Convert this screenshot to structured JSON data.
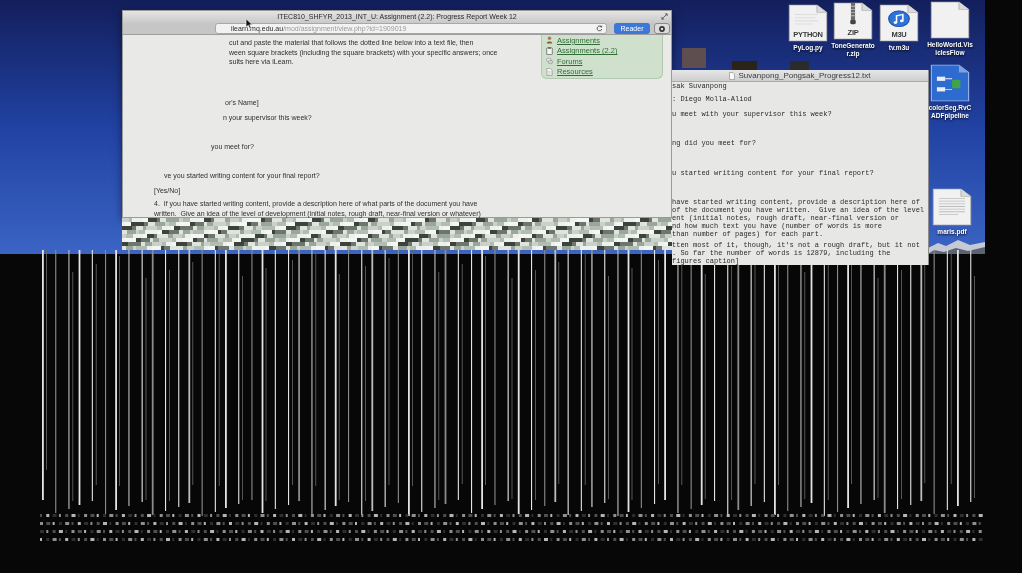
{
  "browser_window": {
    "title": "ITEC810_SHFYR_2013_INT_U: Assignment (2.2): Progress Report Week 12",
    "address": {
      "host": "ilearn.mq.edu.au",
      "path": "/mod/assignment/view.php?id=1909019"
    },
    "reader_button": "Reader",
    "page_lines": [
      "cut and paste the material that follows the dotted line below into a text file, then",
      "ween square brackets (including the square brackets) with your specific answers; once",
      "sults here via iLearn.",
      "or's Name]",
      "n your supervisor this week?",
      "you meet for?",
      "ve you started writing content for your final report?",
      "[Yes/No]",
      "4.  If you have started writing content, provide a description here of what parts of the document you have",
      "written.  Give an idea of the level of development (initial notes, rough draft, near-final version or whatever)"
    ],
    "sidebar_links": [
      {
        "kind": "person",
        "label": "Assignments"
      },
      {
        "kind": "clipboard",
        "label": "Assignments (2.2)"
      },
      {
        "kind": "forum",
        "label": "Forums"
      },
      {
        "kind": "document",
        "label": "Resources"
      }
    ]
  },
  "text_editor": {
    "title": "Suvanpong_Pongsak_Progress12.txt",
    "lines": [
      "sak Suvanpong",
      ": Diego Molla-Aliod",
      "u meet with your supervisor this week?",
      "ng did you meet for?",
      "u started writing content for your final report?",
      "have started writing content, provide a description here of",
      "of the document you have written.  Give an idea of the level",
      "ent (initial notes, rough draft, near-final version or",
      "nd how much text you have (number of words is more",
      "than number of pages) for each part.",
      "tten most of it, though, it's not a rough draft, but it not",
      ". So far the number of words is 12879, including the",
      "figures caption]"
    ]
  },
  "desktop_icons": [
    {
      "kind": "python",
      "badge": "PYTHON",
      "label": "PyLog.py"
    },
    {
      "kind": "zip",
      "badge": "ZIP",
      "label": "ToneGenerator.zip"
    },
    {
      "kind": "audio",
      "badge": "M3U",
      "label": "tv.m3u"
    },
    {
      "kind": "blank",
      "label": "HelloWorld.VisiclesFlow"
    },
    {
      "kind": "diagram",
      "label": "colorSeg.RvCADFpipeline"
    },
    {
      "kind": "pdf",
      "label": "maris.pdf"
    }
  ]
}
